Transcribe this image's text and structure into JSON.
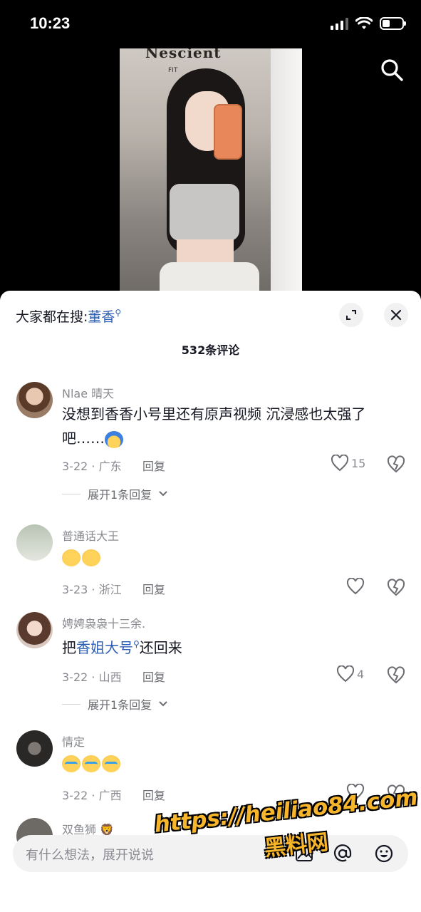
{
  "status_bar": {
    "time": "10:23"
  },
  "video": {
    "store_sign": "Nescient",
    "store_sub": "FIT"
  },
  "sheet": {
    "suggest_label": "大家都在搜:",
    "suggest_keyword": "董香",
    "comment_count": "532条评论"
  },
  "comments": [
    {
      "user": "Nlae 晴天",
      "text": "没想到香香小号里还有原声视频 沉浸感也太强了吧……",
      "emoji": [
        "cold-sweat-emoji"
      ],
      "date_location": "3-22 · 广东",
      "reply_label": "回复",
      "likes": "15",
      "expand_replies": "展开1条回复"
    },
    {
      "user": "普通话大王",
      "text": "",
      "emoji": [
        "laughing-crying-emoji",
        "laughing-crying-emoji"
      ],
      "date_location": "3-23 · 浙江",
      "reply_label": "回复",
      "likes": ""
    },
    {
      "user": "娉娉袅袅十三余.",
      "text_before": "把",
      "text_keyword": "香姐大号",
      "text_after": "还回来",
      "date_location": "3-22 · 山西",
      "reply_label": "回复",
      "likes": "4",
      "expand_replies": "展开1条回复"
    },
    {
      "user": "情定",
      "text": "",
      "emoji": [
        "crying-emoji",
        "crying-emoji",
        "crying-emoji"
      ],
      "date_location": "3-22 · 广西",
      "reply_label": "回复",
      "likes": ""
    },
    {
      "user": "双鱼狮"
    }
  ],
  "input": {
    "placeholder": "有什么想法，展开说说"
  },
  "watermark": {
    "url": "https://heiliao84.com",
    "brand": "黑料网"
  },
  "colors": {
    "keyword_blue": "#2c5eb3",
    "meta_gray": "#8a8b91",
    "watermark_orange": "#f6b52b"
  }
}
